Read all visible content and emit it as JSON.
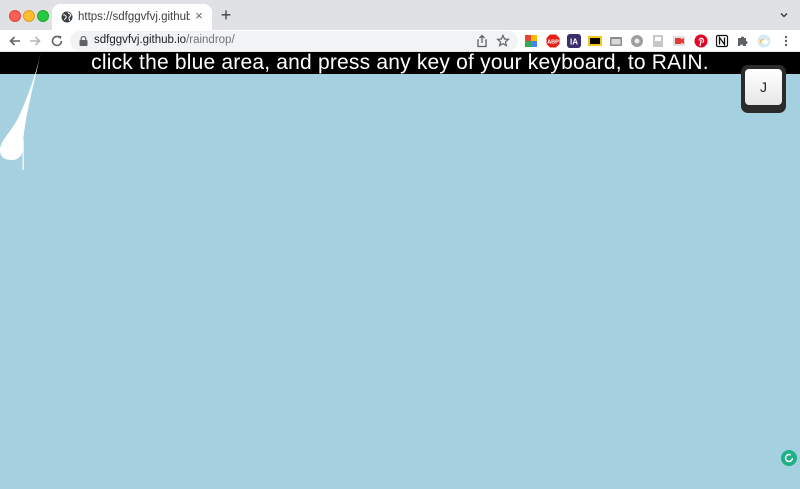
{
  "browser": {
    "tab": {
      "title": "https://sdfggvfvj.github.io/raindrop/",
      "close_label": "×"
    },
    "new_tab_label": "+",
    "address": {
      "host": "sdfggvfvj.github.io",
      "path": "/raindrop/"
    },
    "extensions": [
      "colorful-puzzle-icon",
      "adblock-icon",
      "ia-icon",
      "imdb-icon",
      "folder-icon",
      "gray-circle-icon",
      "doc-icon",
      "video-icon",
      "pinterest-icon",
      "notion-icon",
      "puzzle-icon",
      "profile-icon"
    ],
    "colors": {
      "tab_strip": "#dfe1e5",
      "toolbar": "#ffffff"
    }
  },
  "page": {
    "banner_text": "click the blue area, and press any key of your keyboard, to RAIN.",
    "key_label": "J",
    "colors": {
      "background": "#a4d0df",
      "banner": "#000000",
      "raindrop": "#ffffff",
      "badge": "#1fb183"
    }
  }
}
